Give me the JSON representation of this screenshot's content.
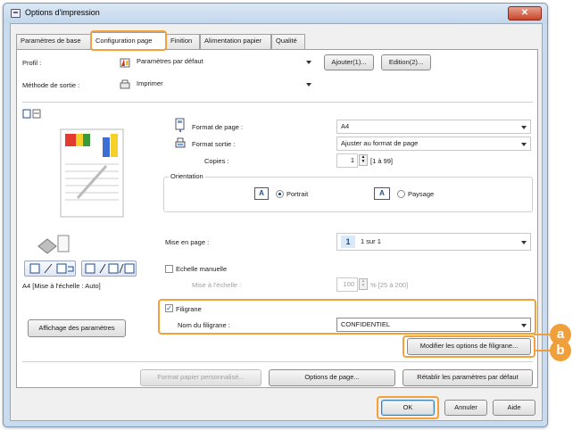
{
  "window": {
    "title": "Options d'impression",
    "close_label": "✕"
  },
  "tabs": [
    {
      "label": "Paramètres de base",
      "active": false
    },
    {
      "label": "Configuration page",
      "active": true
    },
    {
      "label": "Finition",
      "active": false
    },
    {
      "label": "Alimentation papier",
      "active": false
    },
    {
      "label": "Qualité",
      "active": false
    }
  ],
  "profile": {
    "label": "Profil :",
    "value": "Paramètres par défaut",
    "add_button": "Ajouter(1)...",
    "edit_button": "Edition(2)..."
  },
  "output_method": {
    "label": "Méthode de sortie :",
    "value": "Imprimer"
  },
  "page_size": {
    "label": "Format de page :",
    "value": "A4"
  },
  "output_size": {
    "label": "Format sortie :",
    "value": "Ajuster au format de page"
  },
  "copies": {
    "label": "Copies :",
    "value": "1",
    "range": "[1 à 99]"
  },
  "orientation": {
    "label": "Orientation",
    "portrait_label": "Portrait",
    "landscape_label": "Paysage",
    "portrait_icon_letter": "A",
    "landscape_icon_letter": "A",
    "selected": "portrait"
  },
  "layout": {
    "label": "Mise en page :",
    "badge": "1",
    "value": "1 sur 1"
  },
  "manual_scaling": {
    "label": "Echelle manuelle",
    "checked": false,
    "scale_label": "Mise à l'échelle :",
    "scale_value": "100",
    "scale_range": "% [25 à 200]"
  },
  "preview": {
    "caption": "A4 [Mise à l'échelle : Auto]",
    "settings_button": "Affichage des paramètres"
  },
  "watermark": {
    "label": "Filigrane",
    "checked": true,
    "name_label": "Nom du filigrane :",
    "name_value": "CONFIDENTIEL",
    "edit_button": "Modifier les options de filigrane..."
  },
  "bottom_buttons": {
    "custom_paper": "Format papier personnalisé...",
    "page_options": "Options de page...",
    "restore_defaults": "Rétablir les paramètres par défaut"
  },
  "dialog_buttons": {
    "ok": "OK",
    "cancel": "Annuler",
    "help": "Aide"
  },
  "callouts": {
    "a": "a",
    "b": "b"
  },
  "colors": {
    "accent_orange": "#f0a03a",
    "title_bar": "#c9dcef",
    "close_red": "#c7452b"
  }
}
